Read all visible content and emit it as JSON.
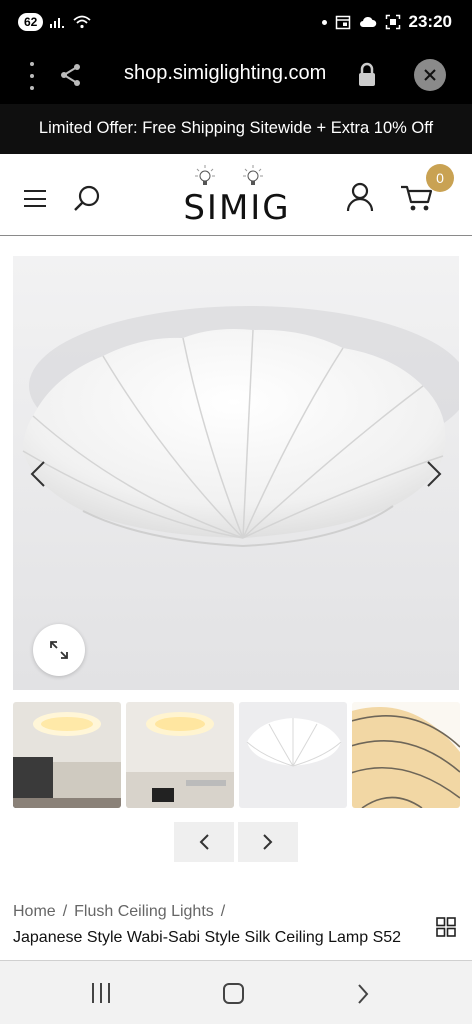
{
  "status_bar": {
    "battery": "62",
    "time": "23:20"
  },
  "browser": {
    "url": "shop.simiglighting.com"
  },
  "promo": {
    "text": "Limited Offer: Free Shipping Sitewide + Extra 10% Off"
  },
  "header": {
    "logo_text": "SIMIG",
    "cart_count": "0"
  },
  "gallery": {
    "thumbnail_count": 4,
    "selected_thumbnail": 3
  },
  "breadcrumb": {
    "home": "Home",
    "separator": "/",
    "category": "Flush Ceiling Lights",
    "trailing_separator": "/"
  },
  "product": {
    "title": "Japanese Style Wabi-Sabi Style Silk Ceiling Lamp S52"
  },
  "colors": {
    "accent_badge": "#c9a253",
    "promo_background": "#0f0f0f",
    "status_background": "#000000"
  }
}
